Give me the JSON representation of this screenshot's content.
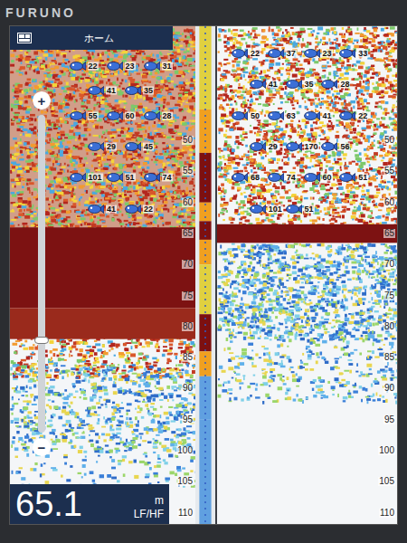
{
  "brand": "FURUNO",
  "home_tab": {
    "label": "ホーム"
  },
  "zoom": {
    "plus": "+",
    "minus": "−",
    "level": 0.29
  },
  "readout": {
    "value": "65.1",
    "unit": "m",
    "mode": "LF/HF"
  },
  "depth_range": {
    "min": 31.6,
    "max": 111.8
  },
  "panels": [
    {
      "name": "LF",
      "ticks": [
        "50",
        "55",
        "60",
        "65",
        "70",
        "75",
        "80",
        "85",
        "90",
        "95",
        "100",
        "105",
        "110"
      ],
      "bands": [
        {
          "kind": "strong",
          "from": 31.6,
          "to": 64,
          "density": 1.0,
          "base": "#b5552e"
        },
        {
          "kind": "solid",
          "from": 64,
          "to": 77,
          "color": "#7d1212"
        },
        {
          "kind": "solid",
          "from": 77,
          "to": 82,
          "color": "#9a2a1c"
        },
        {
          "kind": "strong",
          "from": 80,
          "to": 88,
          "density": 0.7
        },
        {
          "kind": "weak",
          "from": 86,
          "to": 100,
          "density": 0.6
        },
        {
          "kind": "weak",
          "from": 100,
          "to": 106,
          "density": 0.2
        }
      ],
      "fish": [
        {
          "ping": 32,
          "depth": 38,
          "label": "22"
        },
        {
          "ping": 52,
          "depth": 38,
          "label": "23"
        },
        {
          "ping": 72,
          "depth": 38,
          "label": "31"
        },
        {
          "ping": 42,
          "depth": 42,
          "label": "41"
        },
        {
          "ping": 62,
          "depth": 42,
          "label": "35"
        },
        {
          "ping": 32,
          "depth": 46,
          "label": "55"
        },
        {
          "ping": 52,
          "depth": 46,
          "label": "60"
        },
        {
          "ping": 72,
          "depth": 46,
          "label": "28"
        },
        {
          "ping": 42,
          "depth": 51,
          "label": "29"
        },
        {
          "ping": 62,
          "depth": 51,
          "label": "45"
        },
        {
          "ping": 32,
          "depth": 56,
          "label": "101"
        },
        {
          "ping": 52,
          "depth": 56,
          "label": "51"
        },
        {
          "ping": 72,
          "depth": 56,
          "label": "74"
        },
        {
          "ping": 42,
          "depth": 61,
          "label": "41"
        },
        {
          "ping": 62,
          "depth": 61,
          "label": "22"
        }
      ]
    },
    {
      "name": "HF",
      "ticks": [
        "50",
        "55",
        "60",
        "65",
        "70",
        "75",
        "80",
        "85",
        "90",
        "95",
        "100",
        "105",
        "110"
      ],
      "bands": [
        {
          "kind": "strong",
          "from": 31.6,
          "to": 63.5,
          "density": 0.85
        },
        {
          "kind": "solid",
          "from": 63.5,
          "to": 66.5,
          "color": "#7d1212"
        },
        {
          "kind": "weak",
          "from": 66.5,
          "to": 82,
          "density": 0.9
        },
        {
          "kind": "weak",
          "from": 82,
          "to": 92,
          "density": 0.35
        }
      ],
      "fish": [
        {
          "ping": 8,
          "depth": 36,
          "label": "22"
        },
        {
          "ping": 28,
          "depth": 36,
          "label": "37"
        },
        {
          "ping": 48,
          "depth": 36,
          "label": "23"
        },
        {
          "ping": 68,
          "depth": 36,
          "label": "33"
        },
        {
          "ping": 18,
          "depth": 41,
          "label": "41"
        },
        {
          "ping": 38,
          "depth": 41,
          "label": "35"
        },
        {
          "ping": 58,
          "depth": 41,
          "label": "28"
        },
        {
          "ping": 8,
          "depth": 46,
          "label": "50"
        },
        {
          "ping": 28,
          "depth": 46,
          "label": "63"
        },
        {
          "ping": 48,
          "depth": 46,
          "label": "41"
        },
        {
          "ping": 68,
          "depth": 46,
          "label": "22"
        },
        {
          "ping": 18,
          "depth": 51,
          "label": "29"
        },
        {
          "ping": 38,
          "depth": 51,
          "label": "170"
        },
        {
          "ping": 58,
          "depth": 51,
          "label": "56"
        },
        {
          "ping": 8,
          "depth": 56,
          "label": "68"
        },
        {
          "ping": 28,
          "depth": 56,
          "label": "74"
        },
        {
          "ping": 48,
          "depth": 56,
          "label": "60"
        },
        {
          "ping": 68,
          "depth": 56,
          "label": "51"
        },
        {
          "ping": 18,
          "depth": 61,
          "label": "101"
        },
        {
          "ping": 38,
          "depth": 61,
          "label": "51"
        }
      ]
    }
  ],
  "a_scope": [
    {
      "from": 31.6,
      "to": 45,
      "level": 0.3
    },
    {
      "from": 45,
      "to": 52,
      "level": 0.5
    },
    {
      "from": 52,
      "to": 60,
      "level": 0.9
    },
    {
      "from": 60,
      "to": 63,
      "level": 0.5
    },
    {
      "from": 63,
      "to": 66,
      "level": 0.95
    },
    {
      "from": 66,
      "to": 70,
      "level": 0.6
    },
    {
      "from": 70,
      "to": 78,
      "level": 0.35
    },
    {
      "from": 78,
      "to": 84,
      "level": 0.85
    },
    {
      "from": 84,
      "to": 88,
      "level": 0.5
    },
    {
      "from": 88,
      "to": 95,
      "level": 0.2
    },
    {
      "from": 95,
      "to": 111.8,
      "level": 0.1
    }
  ]
}
